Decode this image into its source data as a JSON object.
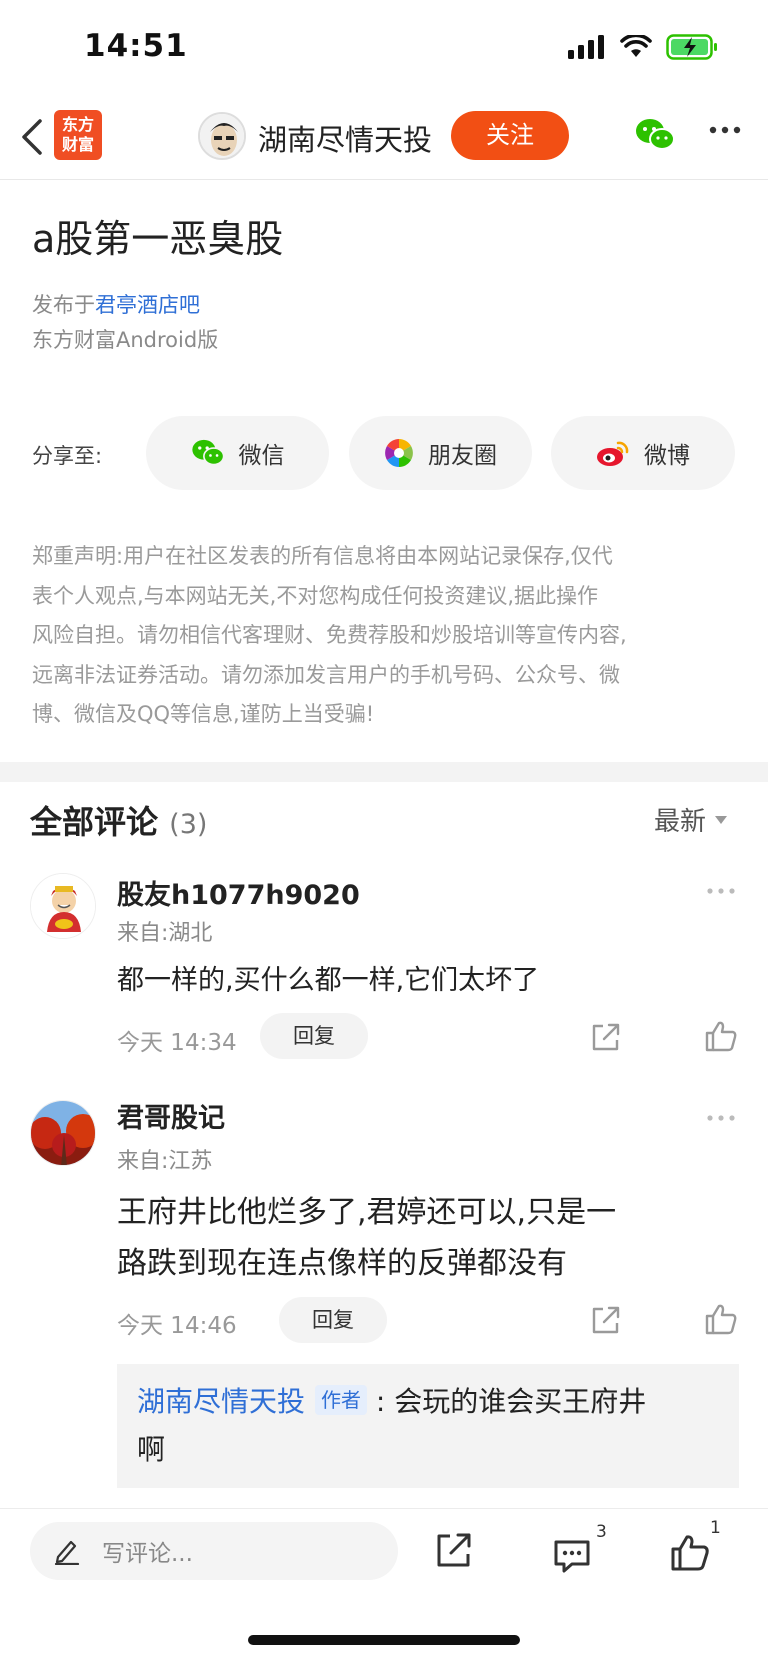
{
  "status_bar": {
    "time": "14:51"
  },
  "nav": {
    "logo_line1": "东方",
    "logo_line2": "财富",
    "author_name": "湖南尽情天投",
    "follow_label": "关注"
  },
  "article": {
    "title": "a股第一恶臭股",
    "published_prefix": "发布于",
    "forum_link": "君亭酒店吧",
    "client": "东方财富Android版"
  },
  "share": {
    "label": "分享至:",
    "wechat": "微信",
    "moments": "朋友圈",
    "weibo": "微博"
  },
  "disclaimer": {
    "line1": "郑重声明:用户在社区发表的所有信息将由本网站记录保存,仅代",
    "line2": "表个人观点,与本网站无关,不对您构成任何投资建议,据此操作",
    "line3": "风险自担。请勿相信代客理财、免费荐股和炒股培训等宣传内容,",
    "line4": "远离非法证券活动。请勿添加发言用户的手机号码、公众号、微",
    "line5": "博、微信及QQ等信息,谨防上当受骗!"
  },
  "comments_header": {
    "title": "全部评论",
    "count": "(3)",
    "sort_label": "最新"
  },
  "comments": [
    {
      "name": "股友h1077h9020",
      "location": "来自:湖北",
      "text": "都一样的,买什么都一样,它们太坏了",
      "time": "今天 14:34",
      "reply_label": "回复"
    },
    {
      "name": "君哥股记",
      "location": "来自:江苏",
      "text_line1": "王府井比他烂多了,君婷还可以,只是一",
      "text_line2": "路跌到现在连点像样的反弹都没有",
      "time": "今天 14:46",
      "reply_label": "回复",
      "reply": {
        "author": "湖南尽情天投",
        "tag": "作者",
        "separator": ":",
        "text_line1": "会玩的谁会买王府井",
        "text_line2": "啊"
      }
    }
  ],
  "bottom_bar": {
    "input_placeholder": "写评论...",
    "comment_count": "3",
    "like_count": "1"
  },
  "colors": {
    "accent_orange": "#f24f14",
    "link_blue": "#2f6fd6",
    "wechat_green": "#2dc100"
  }
}
